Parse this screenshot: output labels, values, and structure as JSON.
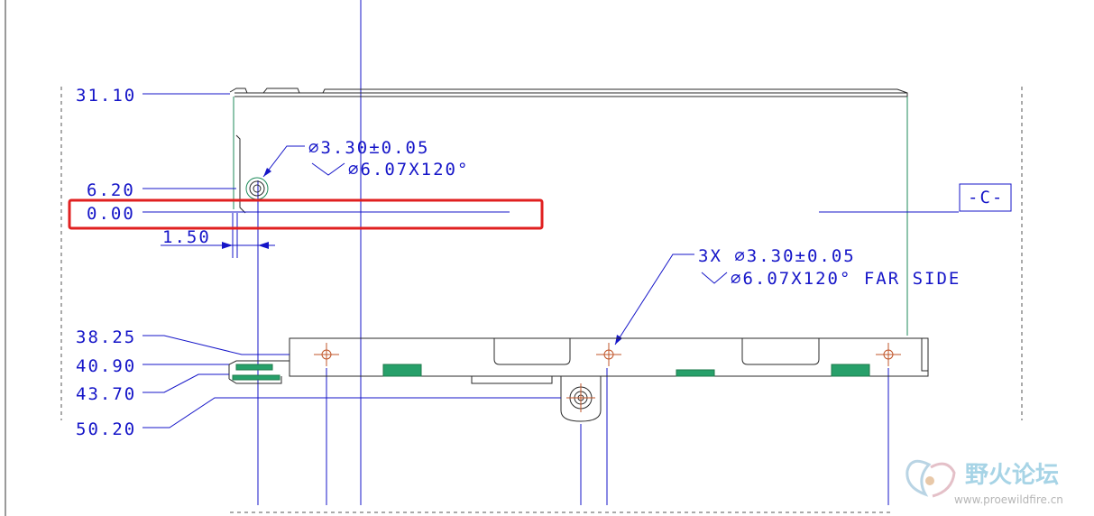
{
  "dimensions": {
    "d_31_10": "31.10",
    "d_6_20": "6.20",
    "d_0_00": "0.00",
    "d_1_50": "1.50",
    "d_38_25": "38.25",
    "d_40_90": "40.90",
    "d_43_70": "43.70",
    "d_50_20": "50.20"
  },
  "notes": {
    "hole_top_line1": "∅3.30±0.05",
    "hole_top_line2": "∅6.07X120°",
    "hole_bottom_line1": "3X ∅3.30±0.05",
    "hole_bottom_line2": "∅6.07X120° FAR SIDE"
  },
  "datum": {
    "label": "-C-"
  },
  "highlight": {
    "color": "#e02020"
  },
  "watermark": {
    "text": "野火论坛",
    "url": "www.proewildfire.cn"
  }
}
